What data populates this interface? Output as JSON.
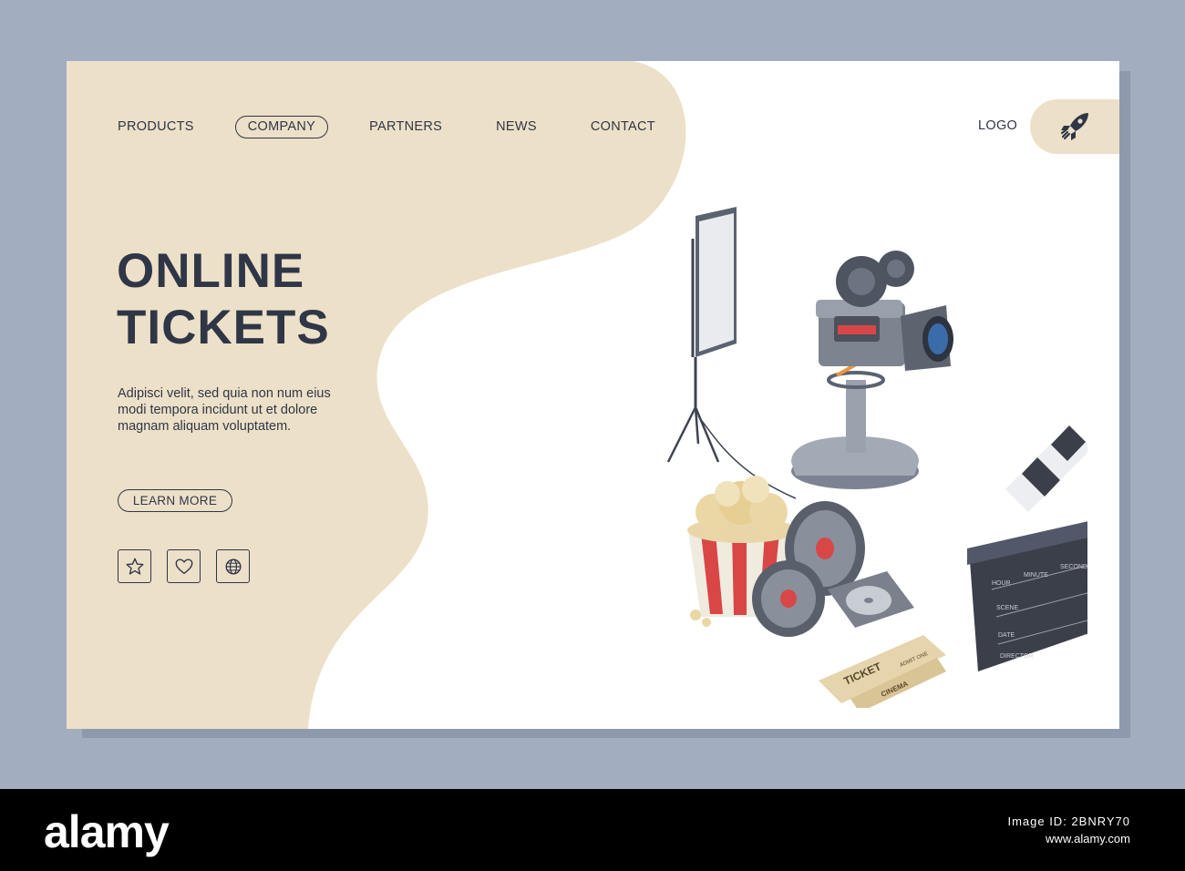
{
  "nav": {
    "items": [
      {
        "label": "PRODUCTS"
      },
      {
        "label": "COMPANY",
        "active": true
      },
      {
        "label": "PARTNERS"
      },
      {
        "label": "NEWS"
      },
      {
        "label": "CONTACT"
      }
    ]
  },
  "logo": {
    "label": "LOGO",
    "icon": "rocket-icon"
  },
  "hero": {
    "title_line1": "ONLINE",
    "title_line2": "TICKETS",
    "description": "Adipisci velit, sed quia non num eius modi tempora incidunt ut et dolore magnam aliquam voluptatem.",
    "cta_label": "LEARN MORE"
  },
  "social_icons": [
    "star-icon",
    "heart-icon",
    "globe-icon"
  ],
  "illustration": {
    "ticket_text": "TICKET",
    "cinema_text": "CINEMA",
    "admit_text": "ADMIT ONE",
    "clapper_labels": [
      "HOUR",
      "MINUTE",
      "SECOND",
      "SCENE",
      "DATE",
      "DIRECTOR"
    ]
  },
  "footer": {
    "brand": "alamy",
    "stock_line1": "Image ID: 2BNRY70",
    "stock_line2": "www.alamy.com"
  },
  "colors": {
    "background": "#a2adbf",
    "beige": "#ede0c9",
    "text": "#2f3646",
    "white": "#ffffff"
  }
}
